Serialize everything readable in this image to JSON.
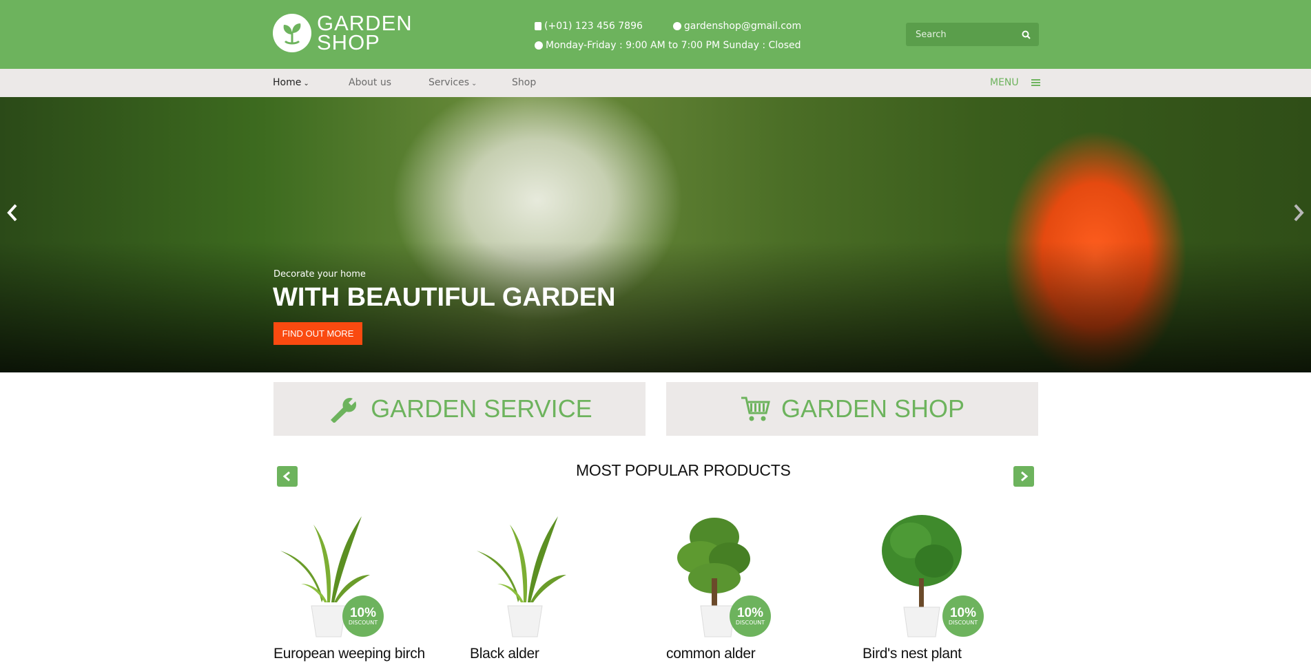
{
  "header": {
    "logo_line1": "GARDEN",
    "logo_line2": "SHOP",
    "phone": "(+01) 123 456 7896",
    "email": "gardenshop@gmail.com",
    "hours": "Monday-Friday : 9:00 AM to 7:00 PM Sunday : Closed",
    "search_placeholder": "Search"
  },
  "nav": {
    "items": [
      {
        "label": "Home"
      },
      {
        "label": "About us"
      },
      {
        "label": "Services"
      },
      {
        "label": "Shop"
      }
    ],
    "menu_label": "MENU"
  },
  "hero": {
    "kicker": "Decorate your home",
    "headline": "WITH BEAUTIFUL GARDEN",
    "cta_label": "FIND OUT MORE"
  },
  "boxes": {
    "service_label": "GARDEN SERVICE",
    "shop_label": "GARDEN SHOP"
  },
  "products": {
    "title": "MOST POPULAR PRODUCTS",
    "items": [
      {
        "name": "European weeping birch",
        "badge_pct": "10%",
        "badge_text": "DISCOUNT"
      },
      {
        "name": "Black alder",
        "badge_pct": "",
        "badge_text": ""
      },
      {
        "name": "common alder",
        "badge_pct": "10%",
        "badge_text": "DISCOUNT"
      },
      {
        "name": "Bird's nest plant",
        "badge_pct": "10%",
        "badge_text": "DISCOUNT"
      }
    ]
  },
  "colors": {
    "brand_green": "#6db35d",
    "cta_orange": "#fa4a10",
    "panel_gray": "#ece9e8"
  }
}
